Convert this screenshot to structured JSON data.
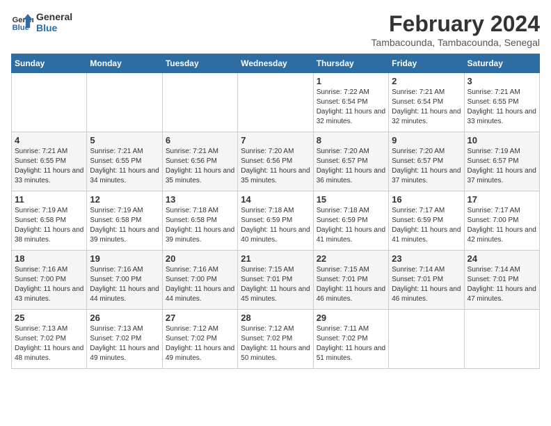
{
  "header": {
    "logo_line1": "General",
    "logo_line2": "Blue",
    "month": "February 2024",
    "location": "Tambacounda, Tambacounda, Senegal"
  },
  "days_of_week": [
    "Sunday",
    "Monday",
    "Tuesday",
    "Wednesday",
    "Thursday",
    "Friday",
    "Saturday"
  ],
  "weeks": [
    [
      {
        "day": "",
        "info": ""
      },
      {
        "day": "",
        "info": ""
      },
      {
        "day": "",
        "info": ""
      },
      {
        "day": "",
        "info": ""
      },
      {
        "day": "1",
        "info": "Sunrise: 7:22 AM\nSunset: 6:54 PM\nDaylight: 11 hours and 32 minutes."
      },
      {
        "day": "2",
        "info": "Sunrise: 7:21 AM\nSunset: 6:54 PM\nDaylight: 11 hours and 32 minutes."
      },
      {
        "day": "3",
        "info": "Sunrise: 7:21 AM\nSunset: 6:55 PM\nDaylight: 11 hours and 33 minutes."
      }
    ],
    [
      {
        "day": "4",
        "info": "Sunrise: 7:21 AM\nSunset: 6:55 PM\nDaylight: 11 hours and 33 minutes."
      },
      {
        "day": "5",
        "info": "Sunrise: 7:21 AM\nSunset: 6:55 PM\nDaylight: 11 hours and 34 minutes."
      },
      {
        "day": "6",
        "info": "Sunrise: 7:21 AM\nSunset: 6:56 PM\nDaylight: 11 hours and 35 minutes."
      },
      {
        "day": "7",
        "info": "Sunrise: 7:20 AM\nSunset: 6:56 PM\nDaylight: 11 hours and 35 minutes."
      },
      {
        "day": "8",
        "info": "Sunrise: 7:20 AM\nSunset: 6:57 PM\nDaylight: 11 hours and 36 minutes."
      },
      {
        "day": "9",
        "info": "Sunrise: 7:20 AM\nSunset: 6:57 PM\nDaylight: 11 hours and 37 minutes."
      },
      {
        "day": "10",
        "info": "Sunrise: 7:19 AM\nSunset: 6:57 PM\nDaylight: 11 hours and 37 minutes."
      }
    ],
    [
      {
        "day": "11",
        "info": "Sunrise: 7:19 AM\nSunset: 6:58 PM\nDaylight: 11 hours and 38 minutes."
      },
      {
        "day": "12",
        "info": "Sunrise: 7:19 AM\nSunset: 6:58 PM\nDaylight: 11 hours and 39 minutes."
      },
      {
        "day": "13",
        "info": "Sunrise: 7:18 AM\nSunset: 6:58 PM\nDaylight: 11 hours and 39 minutes."
      },
      {
        "day": "14",
        "info": "Sunrise: 7:18 AM\nSunset: 6:59 PM\nDaylight: 11 hours and 40 minutes."
      },
      {
        "day": "15",
        "info": "Sunrise: 7:18 AM\nSunset: 6:59 PM\nDaylight: 11 hours and 41 minutes."
      },
      {
        "day": "16",
        "info": "Sunrise: 7:17 AM\nSunset: 6:59 PM\nDaylight: 11 hours and 41 minutes."
      },
      {
        "day": "17",
        "info": "Sunrise: 7:17 AM\nSunset: 7:00 PM\nDaylight: 11 hours and 42 minutes."
      }
    ],
    [
      {
        "day": "18",
        "info": "Sunrise: 7:16 AM\nSunset: 7:00 PM\nDaylight: 11 hours and 43 minutes."
      },
      {
        "day": "19",
        "info": "Sunrise: 7:16 AM\nSunset: 7:00 PM\nDaylight: 11 hours and 44 minutes."
      },
      {
        "day": "20",
        "info": "Sunrise: 7:16 AM\nSunset: 7:00 PM\nDaylight: 11 hours and 44 minutes."
      },
      {
        "day": "21",
        "info": "Sunrise: 7:15 AM\nSunset: 7:01 PM\nDaylight: 11 hours and 45 minutes."
      },
      {
        "day": "22",
        "info": "Sunrise: 7:15 AM\nSunset: 7:01 PM\nDaylight: 11 hours and 46 minutes."
      },
      {
        "day": "23",
        "info": "Sunrise: 7:14 AM\nSunset: 7:01 PM\nDaylight: 11 hours and 46 minutes."
      },
      {
        "day": "24",
        "info": "Sunrise: 7:14 AM\nSunset: 7:01 PM\nDaylight: 11 hours and 47 minutes."
      }
    ],
    [
      {
        "day": "25",
        "info": "Sunrise: 7:13 AM\nSunset: 7:02 PM\nDaylight: 11 hours and 48 minutes."
      },
      {
        "day": "26",
        "info": "Sunrise: 7:13 AM\nSunset: 7:02 PM\nDaylight: 11 hours and 49 minutes."
      },
      {
        "day": "27",
        "info": "Sunrise: 7:12 AM\nSunset: 7:02 PM\nDaylight: 11 hours and 49 minutes."
      },
      {
        "day": "28",
        "info": "Sunrise: 7:12 AM\nSunset: 7:02 PM\nDaylight: 11 hours and 50 minutes."
      },
      {
        "day": "29",
        "info": "Sunrise: 7:11 AM\nSunset: 7:02 PM\nDaylight: 11 hours and 51 minutes."
      },
      {
        "day": "",
        "info": ""
      },
      {
        "day": "",
        "info": ""
      }
    ]
  ]
}
